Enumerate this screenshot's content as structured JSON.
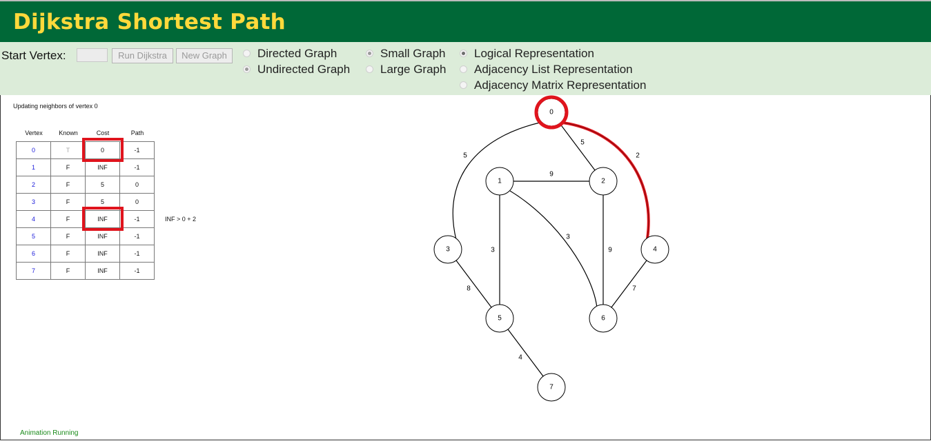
{
  "app": {
    "title": "Dijkstra Shortest Path"
  },
  "controls": {
    "start_label": "Start Vertex:",
    "start_value": "",
    "run_button": "Run Dijkstra",
    "new_graph_button": "New Graph",
    "graph_type": {
      "directed": "Directed Graph",
      "undirected": "Undirected Graph",
      "selected": "undirected"
    },
    "graph_size": {
      "small": "Small Graph",
      "large": "Large Graph",
      "selected": "small"
    },
    "representation": {
      "logical": "Logical Representation",
      "adjacency_list": "Adjacency List Representation",
      "adjacency_matrix": "Adjacency Matrix Representation",
      "selected": "logical"
    }
  },
  "message": "Updating neighbors of vertex 0",
  "table": {
    "headers": [
      "Vertex",
      "Known",
      "Cost",
      "Path"
    ],
    "rows": [
      [
        "0",
        "T",
        "0",
        "-1"
      ],
      [
        "1",
        "F",
        "INF",
        "-1"
      ],
      [
        "2",
        "F",
        "5",
        "0"
      ],
      [
        "3",
        "F",
        "5",
        "0"
      ],
      [
        "4",
        "F",
        "INF",
        "-1"
      ],
      [
        "5",
        "F",
        "INF",
        "-1"
      ],
      [
        "6",
        "F",
        "INF",
        "-1"
      ],
      [
        "7",
        "F",
        "INF",
        "-1"
      ]
    ],
    "highlighted_cost_rows": [
      0,
      4
    ]
  },
  "comparison": "INF > 0 + 2",
  "status": "Animation Running",
  "graph": {
    "nodes": [
      "0",
      "1",
      "2",
      "3",
      "4",
      "5",
      "6",
      "7"
    ],
    "highlighted_node": "0",
    "highlight_color": "#e0141d",
    "edges": [
      {
        "from": "0",
        "to": "3",
        "weight": "5"
      },
      {
        "from": "0",
        "to": "2",
        "weight": "5"
      },
      {
        "from": "0",
        "to": "4",
        "weight": "2",
        "highlighted": true
      },
      {
        "from": "1",
        "to": "2",
        "weight": "9"
      },
      {
        "from": "1",
        "to": "5",
        "weight": "3"
      },
      {
        "from": "1",
        "to": "6",
        "weight": "3"
      },
      {
        "from": "2",
        "to": "6",
        "weight": "9"
      },
      {
        "from": "4",
        "to": "6",
        "weight": "7"
      },
      {
        "from": "3",
        "to": "5",
        "weight": "8"
      },
      {
        "from": "5",
        "to": "7",
        "weight": "4"
      }
    ]
  },
  "colors": {
    "header_bg": "#006837",
    "title": "#ffd93b",
    "controls_bg": "#dcecd9",
    "vertex_link": "#1a1adb",
    "status": "#1a8a1a"
  }
}
